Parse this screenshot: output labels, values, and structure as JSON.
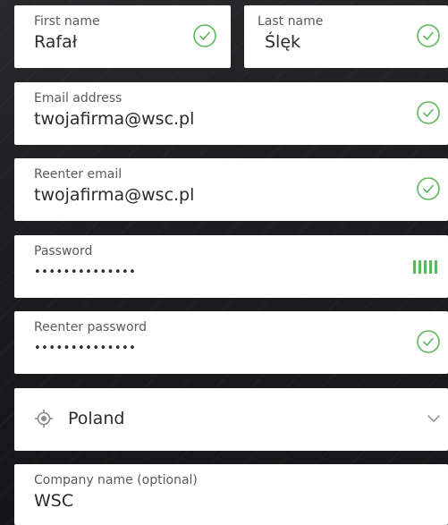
{
  "form": {
    "first_name": {
      "label": "First name",
      "value": "Rafał"
    },
    "last_name": {
      "label": "Last name",
      "value": "Ślęk"
    },
    "email": {
      "label": "Email address",
      "value": "twojafirma@wsc.pl"
    },
    "reenter_email": {
      "label": "Reenter email",
      "value": "twojafirma@wsc.pl"
    },
    "password": {
      "label": "Password",
      "value": "••••••••••••••",
      "strength_bars": 5,
      "strength_color": "#5cb85c"
    },
    "reenter_password": {
      "label": "Reenter password",
      "value": "••••••••••••••"
    },
    "country": {
      "value": "Poland"
    },
    "company": {
      "label": "Company name (optional)",
      "value": "WSC"
    }
  },
  "colors": {
    "valid": "#5cb85c",
    "field_bg": "#ffffff",
    "page_bg": "#1c1c1e"
  },
  "icons": {
    "valid": "check-circle-icon",
    "country": "location-target-icon",
    "dropdown": "chevron-down-icon"
  }
}
